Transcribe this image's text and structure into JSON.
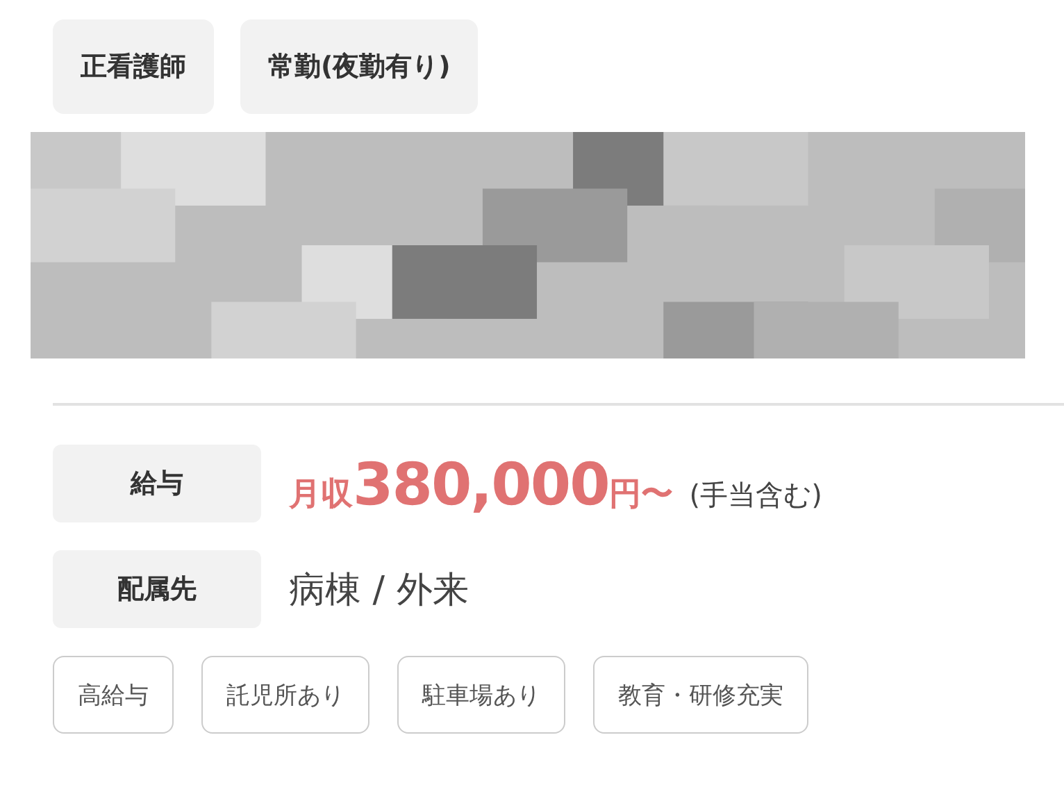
{
  "categories": [
    "正看護師",
    "常勤(夜勤有り)"
  ],
  "details": [
    {
      "kind": "salary",
      "label": "給与",
      "prefix": "月収",
      "amount": "380,000",
      "unit": "円〜",
      "note": "(手当含む)"
    },
    {
      "kind": "text",
      "label": "配属先",
      "value": "病棟 / 外来"
    }
  ],
  "features": [
    "高給与",
    "託児所あり",
    "駐車場あり",
    "教育・研修充実"
  ]
}
